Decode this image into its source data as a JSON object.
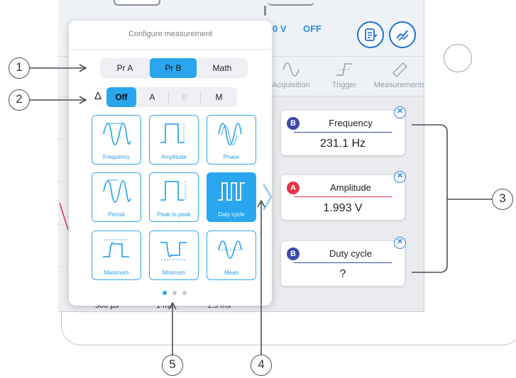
{
  "app": {
    "topbar": {
      "voltage_value": "0 V",
      "state_label": "OFF"
    },
    "tabs": [
      {
        "label": "Acquisition",
        "icon": "sine-wave-icon"
      },
      {
        "label": "Trigger",
        "icon": "trigger-edge-icon"
      },
      {
        "label": "Measurements",
        "icon": "ruler-icon"
      }
    ],
    "timebase_labels": [
      "500 µs",
      "1 ms",
      "1.5 ms"
    ]
  },
  "popover": {
    "title": "Configure measurement",
    "source_options": [
      {
        "label": "Pr A",
        "selected": false
      },
      {
        "label": "Pr B",
        "selected": true
      },
      {
        "label": "Math",
        "selected": false
      }
    ],
    "delta_symbol": "Δ",
    "delta_options": [
      {
        "label": "Off",
        "selected": true,
        "enabled": true
      },
      {
        "label": "A",
        "selected": false,
        "enabled": true
      },
      {
        "label": "B",
        "selected": false,
        "enabled": false
      },
      {
        "label": "M",
        "selected": false,
        "enabled": true
      }
    ],
    "measurement_types": [
      {
        "label": "Frequency",
        "icon": "frequency-wave-icon",
        "selected": false
      },
      {
        "label": "Amplitude",
        "icon": "amplitude-square-icon",
        "selected": false
      },
      {
        "label": "Phase",
        "icon": "phase-wave-icon",
        "selected": false
      },
      {
        "label": "Period",
        "icon": "period-wave-icon",
        "selected": false
      },
      {
        "label": "Peak to peak",
        "icon": "peak-to-peak-icon",
        "selected": false
      },
      {
        "label": "Duty cycle",
        "icon": "duty-cycle-icon",
        "selected": true
      },
      {
        "label": "Maximum",
        "icon": "maximum-icon",
        "selected": false
      },
      {
        "label": "Minimum",
        "icon": "minimum-icon",
        "selected": false
      },
      {
        "label": "Mean",
        "icon": "mean-icon",
        "selected": false
      }
    ],
    "page_indicator": {
      "pages": 3,
      "current": 1
    }
  },
  "measurements": [
    {
      "probe": "B",
      "probe_color": "#3d4aa8",
      "label": "Frequency",
      "value": "231.1 Hz",
      "line_color": "#3b4a9c"
    },
    {
      "probe": "A",
      "probe_color": "#e8334a",
      "label": "Amplitude",
      "value": "1.993 V",
      "line_color": "#e8334a"
    },
    {
      "probe": "B",
      "probe_color": "#3d4aa8",
      "label": "Duty cycle",
      "value": "?",
      "line_color": "#3b4a9c"
    }
  ],
  "callouts": [
    "1",
    "2",
    "3",
    "4",
    "5"
  ],
  "colors": {
    "accent": "#2aa6ee",
    "tile_border": "#34a8ec",
    "probe_a": "#e8334a",
    "probe_b": "#3d4aa8"
  }
}
